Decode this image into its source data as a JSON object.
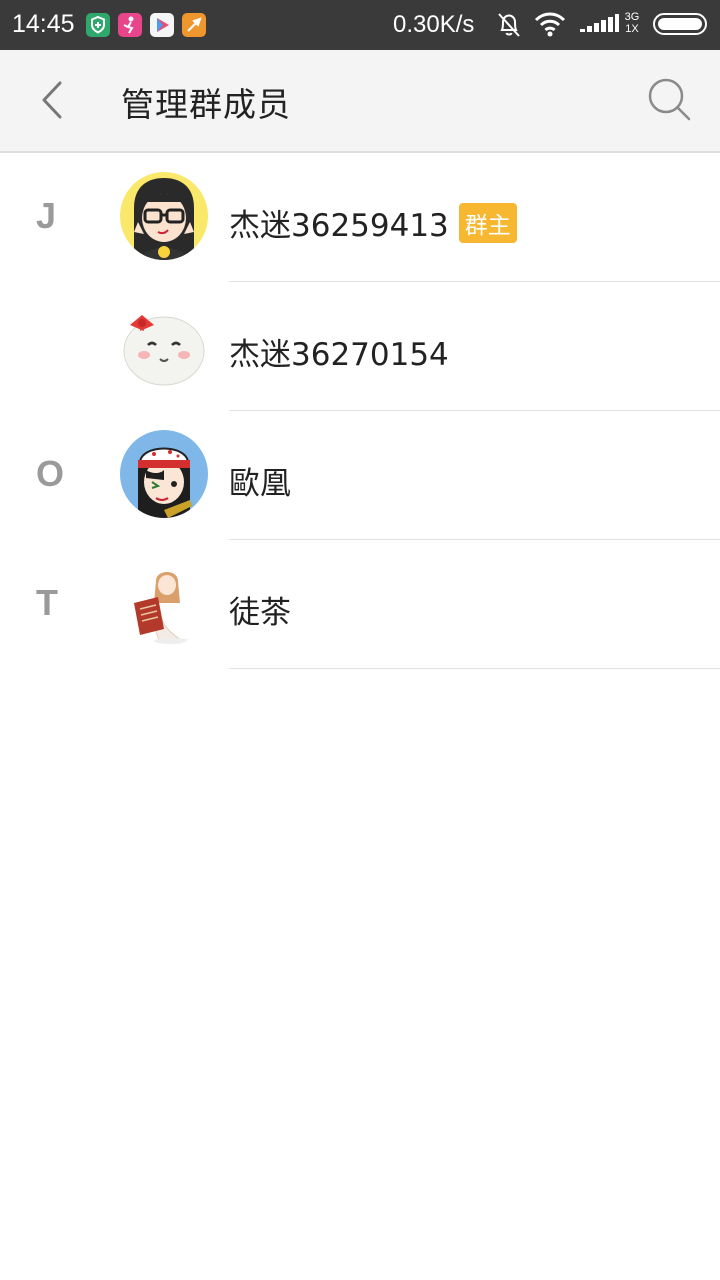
{
  "status_bar": {
    "time": "14:45",
    "net_speed": "0.30K/s",
    "network_type_top": "3G",
    "network_type_bottom": "1X",
    "app_icons": [
      {
        "name": "shield-app-icon",
        "color": "#2fa86b"
      },
      {
        "name": "dance-app-icon",
        "color": "#e8458b"
      },
      {
        "name": "video-app-icon",
        "color": "#f5f5f5"
      },
      {
        "name": "brush-app-icon",
        "color": "#f0962e"
      }
    ],
    "icons": [
      "bell-muted-icon",
      "wifi-icon",
      "signal-icon",
      "battery-icon"
    ]
  },
  "header": {
    "title": "管理群成员",
    "back_icon": "chevron-left-icon",
    "search_icon": "search-icon"
  },
  "members": [
    {
      "letter": "J",
      "name": "杰迷36259413",
      "badge": "群主",
      "avatar": "glasses-girl-avatar"
    },
    {
      "letter": "",
      "name": "杰迷36270154",
      "badge": "",
      "avatar": "round-face-bow-avatar"
    },
    {
      "letter": "O",
      "name": "歐凰",
      "badge": "",
      "avatar": "cap-girl-avatar"
    },
    {
      "letter": "T",
      "name": "徒茶",
      "badge": "",
      "avatar": "reading-girl-avatar"
    }
  ],
  "colors": {
    "status_bar_bg": "#3a3a3a",
    "title_bar_bg": "#f4f4f4",
    "badge_bg": "#f7b731",
    "letter_color": "#9a9a9a"
  }
}
